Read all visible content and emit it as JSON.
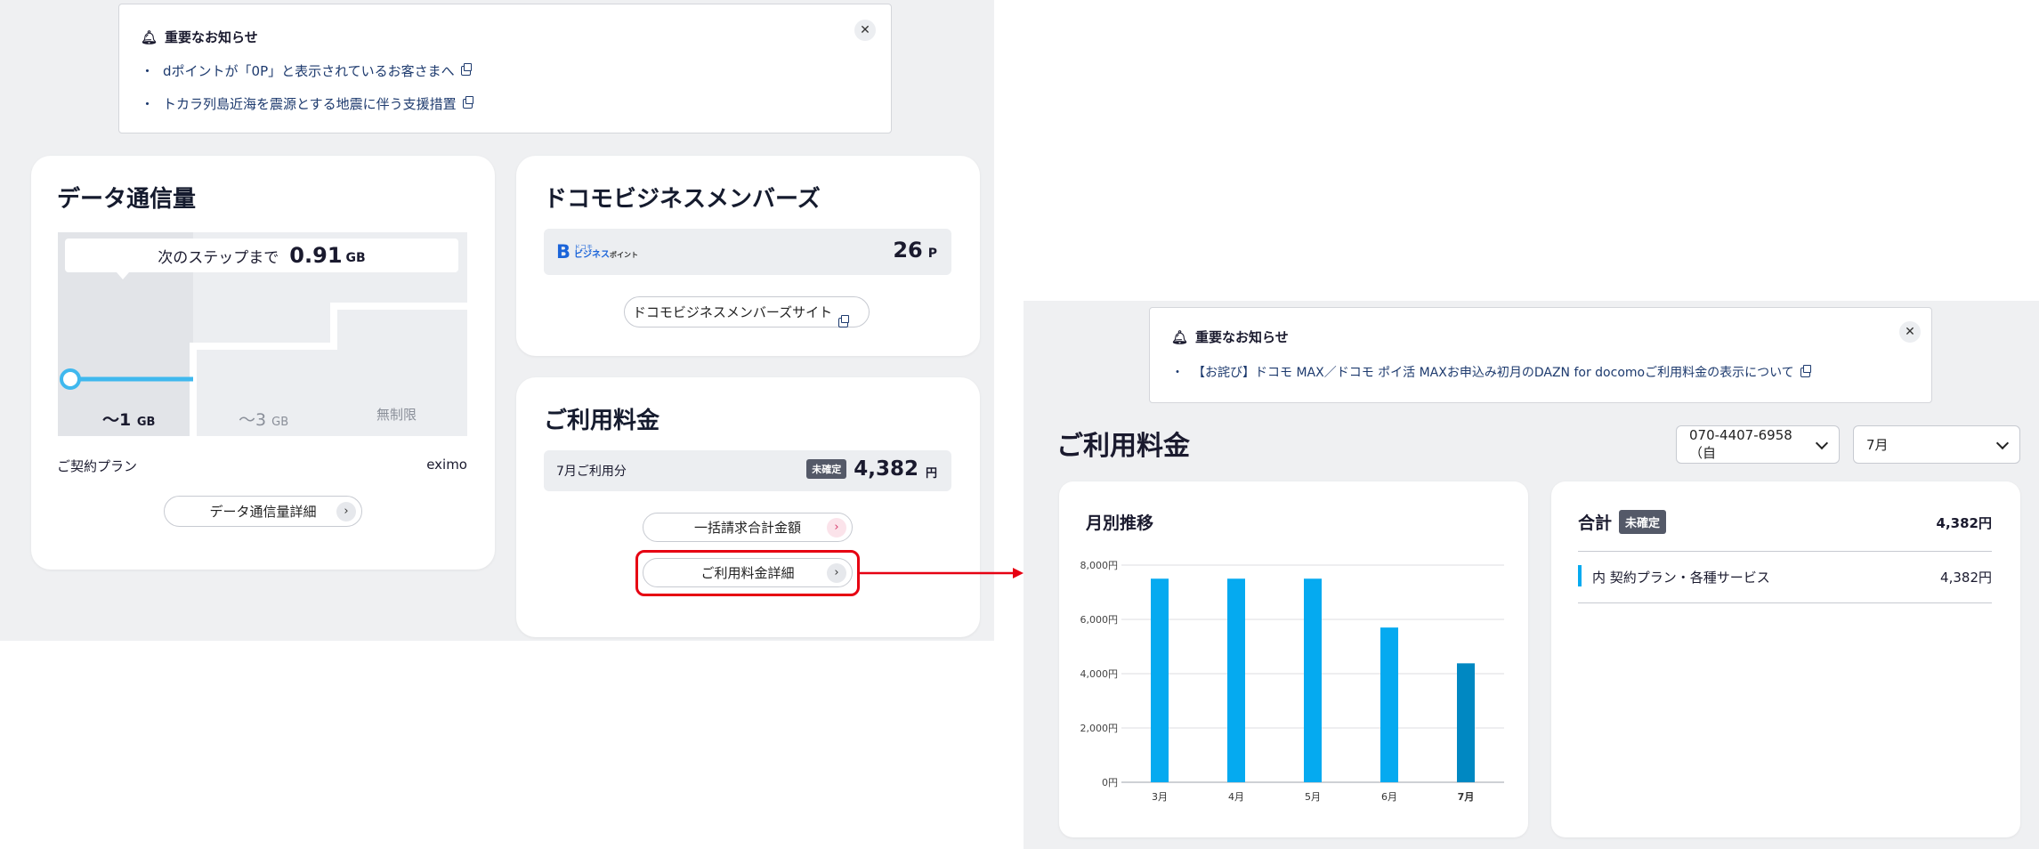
{
  "left": {
    "notice": {
      "title": "重要なお知らせ",
      "links": [
        "dポイントが「0P」と表示されているお客さまへ",
        "トカラ列島近海を震源とする地震に伴う支援措置"
      ]
    },
    "data_card": {
      "title": "データ通信量",
      "tooltip_prefix": "次のステップまで",
      "tooltip_value": "0.91",
      "tooltip_unit": "GB",
      "steps": [
        {
          "label": "〜1",
          "unit": "GB"
        },
        {
          "label": "〜3",
          "unit": "GB"
        },
        {
          "label": "無制限",
          "unit": ""
        }
      ],
      "plan_label": "ご契約プラン",
      "plan_value": "eximo",
      "detail_button": "データ通信量詳細"
    },
    "business_card": {
      "title": "ドコモビジネスメンバーズ",
      "logo_small": "ドコモ",
      "logo_main": "ビジネス",
      "logo_suffix": "ポイント",
      "points_value": "26",
      "points_unit": "P",
      "site_button": "ドコモビジネスメンバーズサイト"
    },
    "fee_card": {
      "title": "ご利用料金",
      "month_label": "7月ご利用分",
      "status": "未確定",
      "amount": "4,382",
      "currency": "円",
      "bulk_button": "一括請求合計金額",
      "detail_button": "ご利用料金詳細"
    }
  },
  "right": {
    "notice": {
      "title": "重要なお知らせ",
      "links": [
        "【お詫び】ドコモ MAX／ドコモ ポイ活 MAXお申込み初月のDAZN for docomoご利用料金の表示について"
      ]
    },
    "page_title": "ご利用料金",
    "phone_select": "070-4407-6958（自",
    "month_select": "7月",
    "chart_card_title": "月別推移",
    "total": {
      "label": "合計",
      "status": "未確定",
      "amount": "4,382円",
      "item_label": "内 契約プラン・各種サービス",
      "item_amount": "4,382円"
    }
  },
  "colors": {
    "bar": "#05aaf0",
    "bar_current": "#0088c2",
    "highlight": "#e60012",
    "gauge": "#3fb8ee"
  },
  "chart_data": {
    "type": "bar",
    "title": "月別推移",
    "categories": [
      "3月",
      "4月",
      "5月",
      "6月",
      "7月"
    ],
    "values": [
      7500,
      7500,
      7500,
      5700,
      4382
    ],
    "yticks": [
      "0円",
      "2,000円",
      "4,000円",
      "6,000円",
      "8,000円"
    ],
    "ylim": [
      0,
      8000
    ],
    "highlight_index": 4,
    "grid": true
  }
}
